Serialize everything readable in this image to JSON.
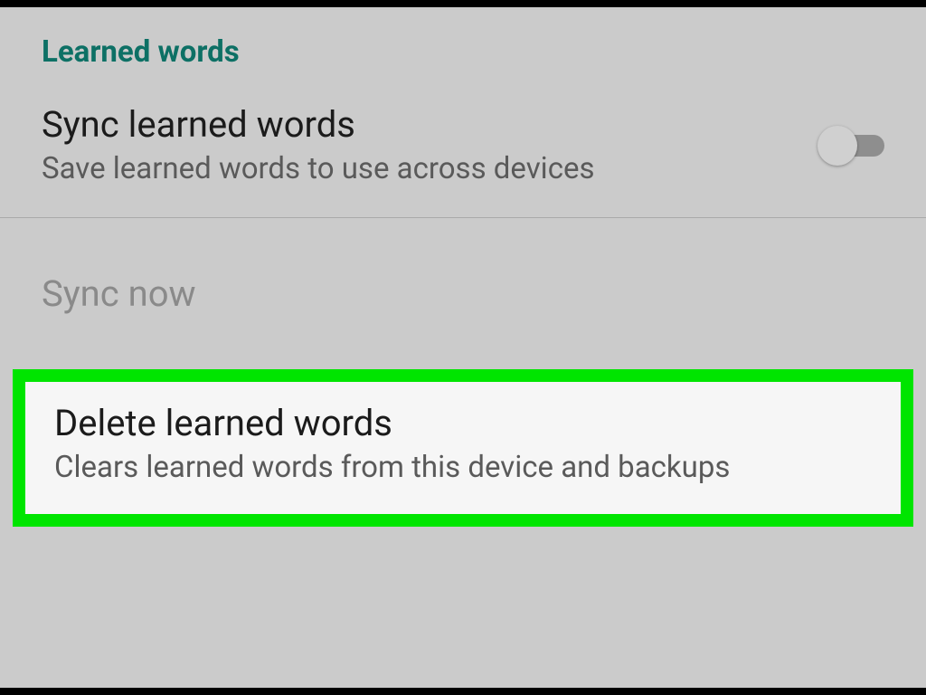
{
  "section": {
    "header": "Learned words"
  },
  "sync_setting": {
    "title": "Sync learned words",
    "subtitle": "Save learned words to use across devices",
    "enabled": false
  },
  "sync_now": {
    "title": "Sync now"
  },
  "delete_setting": {
    "title": "Delete learned words",
    "subtitle": "Clears learned words from this device and backups"
  },
  "colors": {
    "accent": "#0d7065",
    "highlight_border": "#00e500"
  }
}
